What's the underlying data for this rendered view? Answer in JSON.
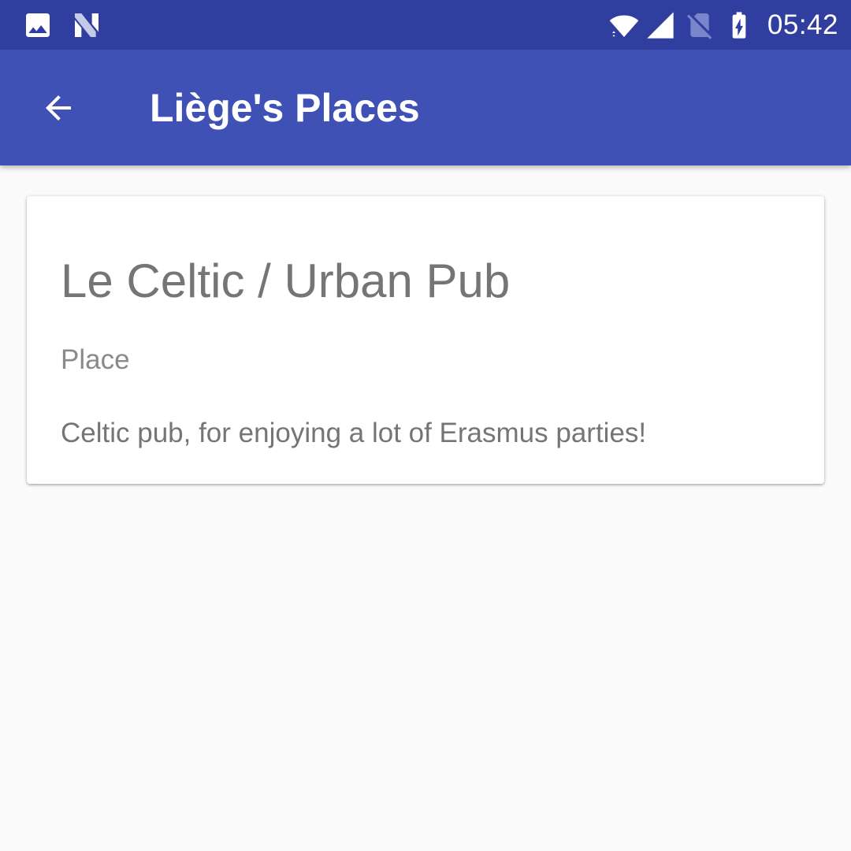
{
  "status_bar": {
    "time": "05:42",
    "icons": [
      "image-icon",
      "n-logo-icon",
      "wifi-icon",
      "signal-icon",
      "no-sim-icon",
      "battery-charging-icon"
    ]
  },
  "app_bar": {
    "title": "Liège's Places",
    "back_icon": "arrow-back-icon"
  },
  "card": {
    "title": "Le Celtic / Urban Pub",
    "type": "Place",
    "description": "Celtic pub, for enjoying a lot of Erasmus parties!"
  },
  "colors": {
    "status_bar": "#303f9f",
    "app_bar": "#3f51b5",
    "background": "#fafafa",
    "card": "#ffffff",
    "text_secondary": "#757575"
  }
}
